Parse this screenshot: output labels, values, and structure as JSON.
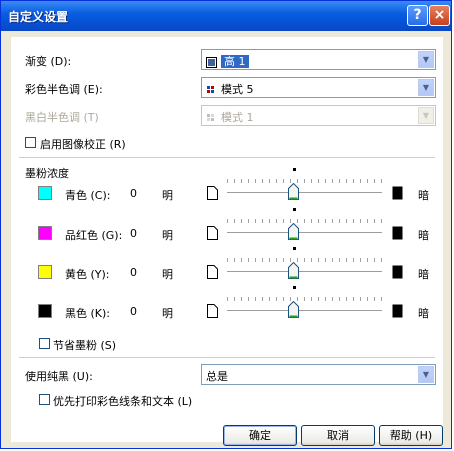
{
  "window": {
    "title": "自定义设置"
  },
  "gradient": {
    "label": "渐变 (D):",
    "value": "高 1"
  },
  "color_halftone": {
    "label": "彩色半色调 (E):",
    "value": "模式 5"
  },
  "bw_halftone": {
    "label": "黑白半色调 (T)",
    "value": "模式 1"
  },
  "image_correction": {
    "label": "启用图像校正 (R)",
    "checked": false
  },
  "toner_density": {
    "title": "墨粉浓度",
    "light_label": "明",
    "dark_label": "暗",
    "channels": [
      {
        "label": "青色 (C):",
        "value": "0",
        "color": "#00ffff"
      },
      {
        "label": "品红色 (G):",
        "value": "0",
        "color": "#ff00ff"
      },
      {
        "label": "黄色 (Y):",
        "value": "0",
        "color": "#ffff00"
      },
      {
        "label": "黑色 (K):",
        "value": "0",
        "color": "#000000"
      }
    ]
  },
  "toner_save": {
    "label": "节省墨粉 (S)",
    "checked": false
  },
  "pure_black": {
    "label": "使用纯黑 (U):",
    "value": "总是"
  },
  "print_priority": {
    "label": "优先打印彩色线条和文本 (L)",
    "checked": false
  },
  "buttons": {
    "ok": "确定",
    "cancel": "取消",
    "help": "帮助 (H)"
  },
  "titlebar_buttons": {
    "help": "?",
    "close": "×"
  }
}
